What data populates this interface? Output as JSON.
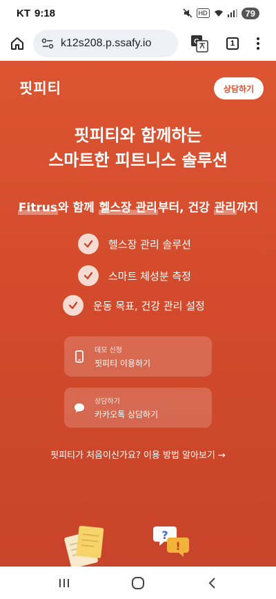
{
  "status_bar": {
    "carrier": "KT",
    "time": "9:18",
    "network": "HD",
    "battery": "79"
  },
  "browser": {
    "url": "k12s208.p.ssafy.io",
    "tab_count": "1"
  },
  "header": {
    "brand": "핏피티",
    "consult_button": "상담하기"
  },
  "hero": {
    "title_line1": "핏피티와 함께하는",
    "title_line2": "스마트한 피트니스 솔루션",
    "subtitle": {
      "hl1": "Fitrus",
      "t1": "와 함께 ",
      "hl2": "헬스장 관리",
      "t2": "부터, 건강 ",
      "hl3": "관리",
      "t3": "까지"
    }
  },
  "features": [
    "헬스장 관리 솔루션",
    "스마트 체성분 측정",
    "운동 목표, 건강 관리 설정"
  ],
  "cards": [
    {
      "kicker": "데모 신청",
      "label": "핏피티 이용하기",
      "icon": "phone-icon"
    },
    {
      "kicker": "상담하기",
      "label": "카카오톡 상담하기",
      "icon": "chat-icon"
    }
  ],
  "guide_link": "핏피티가 처음이신가요? 이용 방법 알아보기 →",
  "colors": {
    "primary": "#d9522f",
    "card_bg": "rgba(255,255,255,0.18)",
    "check_bg": "#f6dbd2"
  }
}
